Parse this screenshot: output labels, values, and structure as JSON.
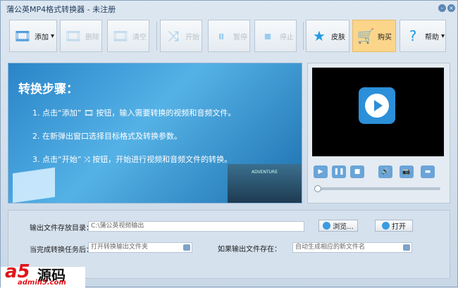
{
  "window": {
    "title": "蒲公英MP4格式转换器 - 未注册",
    "minimize": "–",
    "close": "×"
  },
  "toolbar": [
    {
      "label": "添加",
      "icon": "🎞",
      "dis": false,
      "arrow": "▾"
    },
    {
      "label": "删除",
      "icon": "🎞",
      "dis": true
    },
    {
      "label": "清空",
      "icon": "🎞",
      "dis": true
    },
    {
      "label": "开始",
      "icon": "⤨",
      "dis": true
    },
    {
      "label": "暂停",
      "icon": "⏸",
      "dis": true
    },
    {
      "label": "停止",
      "icon": "⏹",
      "dis": true
    },
    {
      "label": "皮肤",
      "icon": "★"
    },
    {
      "label": "购买",
      "icon": "🛒"
    },
    {
      "label": "帮助",
      "icon": "?",
      "arrow": "▾"
    }
  ],
  "banner": {
    "heading": "转换步骤：",
    "steps": [
      "1. 点击“添加” 🎞 按钮，输入需要转换的视频和音频文件。",
      "2. 在新弹出窗口选择目标格式及转换参数。",
      "3. 点击“开始” ⤨ 按钮，开始进行视频和音频文件的转换。"
    ],
    "poster_text": "ADVENTURE"
  },
  "player": {
    "controls": [
      "▶",
      "❚❚",
      "■",
      "🔊",
      "📷",
      "▬"
    ],
    "progress": 0
  },
  "output": {
    "dir_label": "输出文件存放目录：",
    "dir_value": "C:\\蒲公英视频输出",
    "browse": "浏览...",
    "open": "打开",
    "after_label": "当完成转换任务后：",
    "after_value": "打开转换输出文件夹",
    "exists_label": "如果输出文件存在：",
    "exists_value": "自动生成相应的新文件名"
  },
  "watermark": {
    "brand": "a5",
    "text": "源码",
    "url": "admin5.com"
  }
}
